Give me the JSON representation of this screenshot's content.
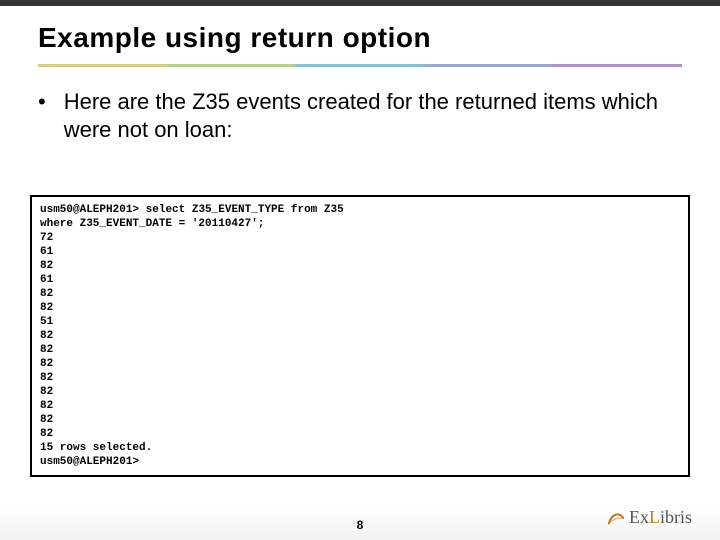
{
  "title": "Example using return option",
  "bullets": [
    "Here are the Z35 events created for the returned items which were not on loan:"
  ],
  "code": {
    "prompt": "usm50@ALEPH201>",
    "query_line_1": "select Z35_EVENT_TYPE from Z35",
    "query_line_2": "where Z35_EVENT_DATE = '20110427';",
    "results": [
      "72",
      "61",
      "82",
      "61",
      "82",
      "82",
      "51",
      "82",
      "82",
      "82",
      "82",
      "82",
      "82",
      "82",
      "82"
    ],
    "rows_selected_text": "15 rows selected.",
    "end_prompt": "usm50@ALEPH201>"
  },
  "page_number": "8",
  "logo": {
    "prefix": "Ex",
    "letter_l": "L",
    "suffix": "ibris"
  }
}
